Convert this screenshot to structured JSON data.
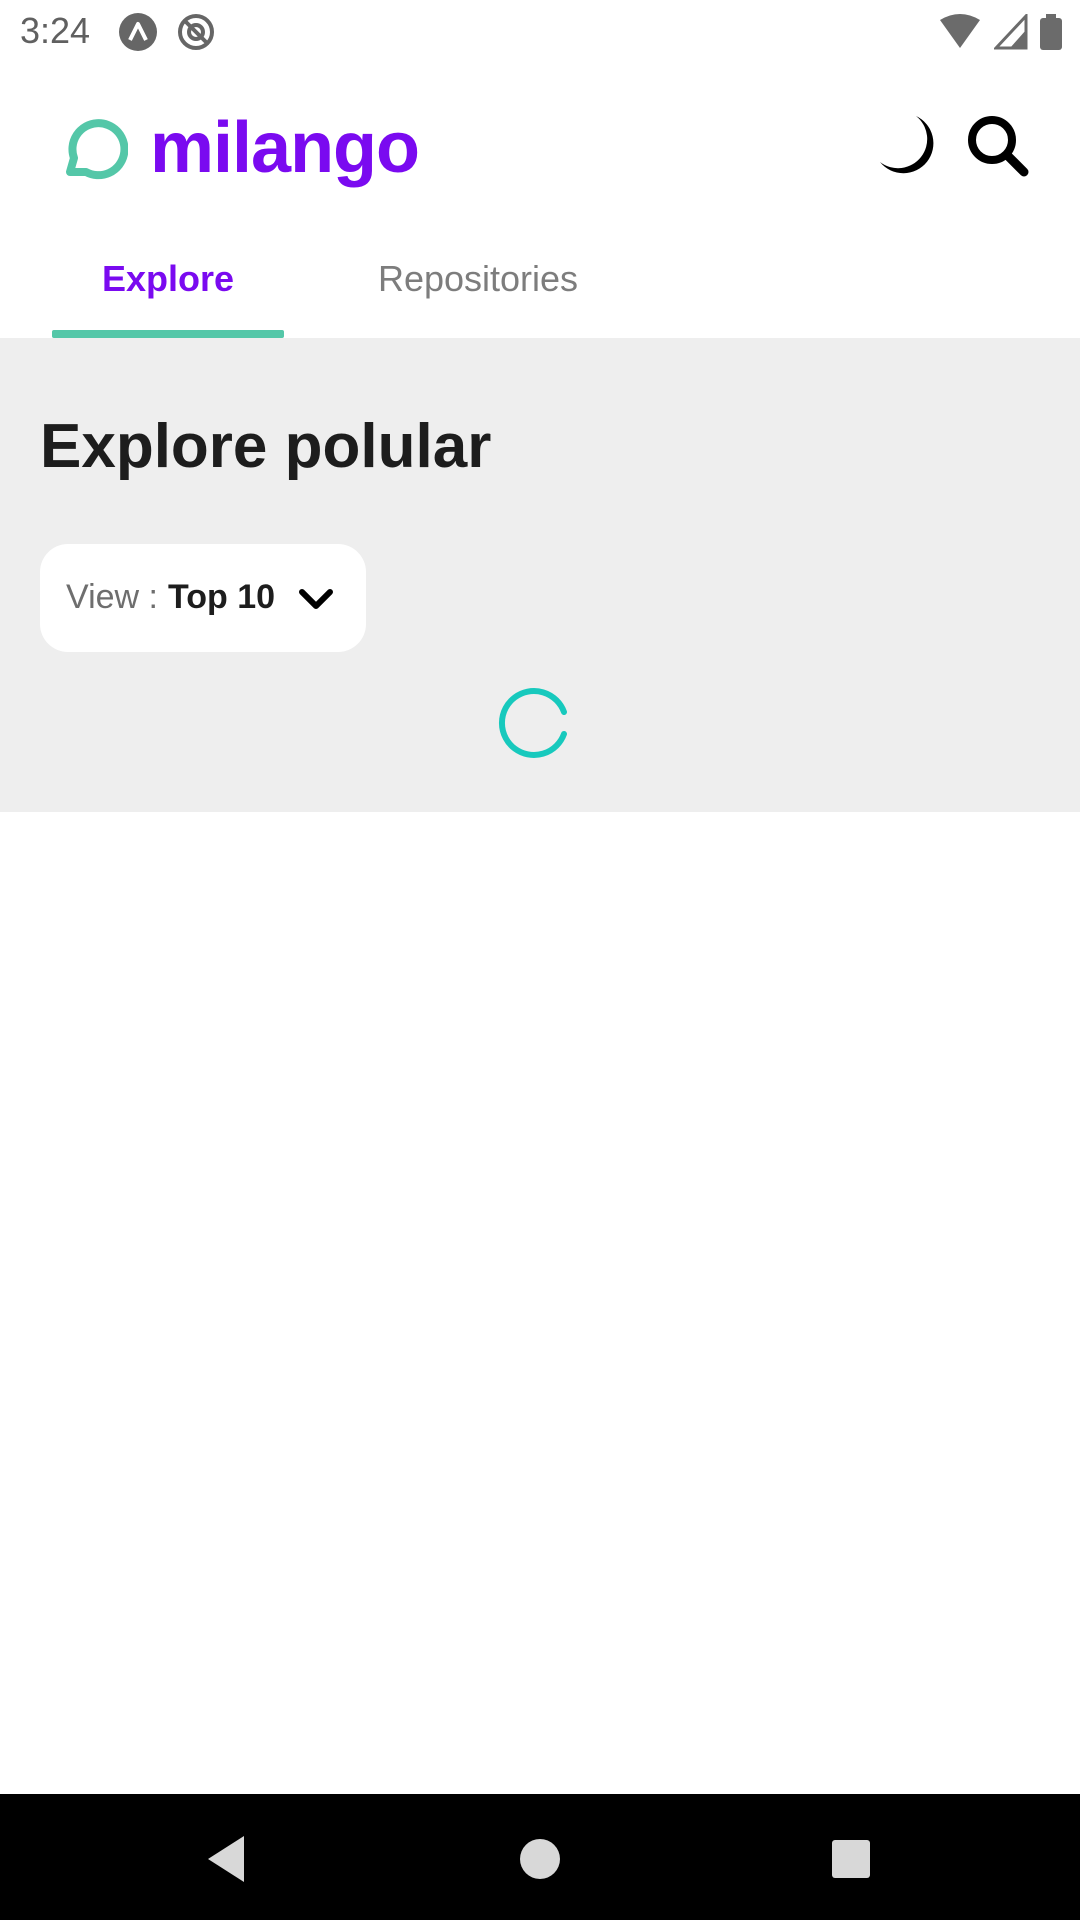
{
  "status_bar": {
    "time": "3:24"
  },
  "header": {
    "brand": "milango",
    "brand_color": "#7a0af0",
    "accent_color": "#54c7a8",
    "icons": [
      "chat-bubble-logo-icon",
      "moon-icon",
      "search-icon"
    ]
  },
  "tabs": [
    {
      "label": "Explore",
      "selected": true
    },
    {
      "label": "Repositories",
      "selected": false
    }
  ],
  "main": {
    "title": "Explore polular",
    "view_select": {
      "label": "View :",
      "value": "Top 10"
    },
    "loading": true,
    "spinner_color": "#17c9bd"
  },
  "nav_bar": {
    "buttons": [
      "back",
      "home",
      "recents"
    ]
  }
}
